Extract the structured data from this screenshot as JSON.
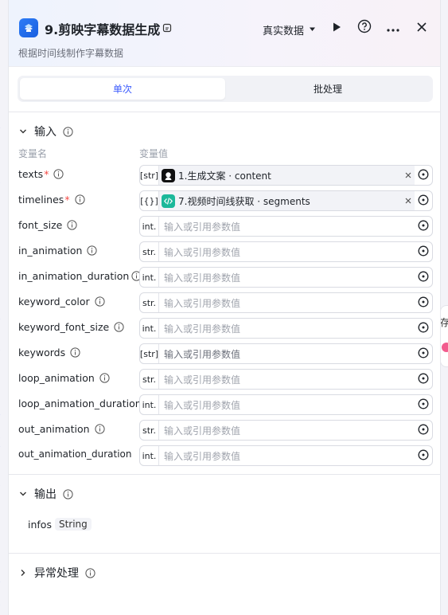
{
  "canvas": {
    "right_node_label": "存"
  },
  "header": {
    "title": "9.剪映字幕数据生成",
    "description": "根据时间线制作字幕数据",
    "data_mode": "真实数据",
    "accent_color": "#2d7cf6"
  },
  "tabs": [
    {
      "label": "单次",
      "active": true
    },
    {
      "label": "批处理",
      "active": false
    }
  ],
  "input_section": {
    "title": "输入",
    "col_name": "变量名",
    "col_value": "变量值",
    "rows": [
      {
        "name": "texts",
        "required": "*",
        "type": "[str]",
        "ref_label": "1.生成文案 · content",
        "ref_icon": "ai-avatar-icon"
      },
      {
        "name": "timelines",
        "required": "*",
        "type": "[{}]",
        "ref_label": "7.视频时间线获取 · segments",
        "ref_icon": "code-icon"
      },
      {
        "name": "font_size",
        "type": "int.",
        "placeholder": "输入或引用参数值"
      },
      {
        "name": "in_animation",
        "type": "str.",
        "placeholder": "输入或引用参数值"
      },
      {
        "name": "in_animation_duration",
        "type": "int.",
        "placeholder": "输入或引用参数值"
      },
      {
        "name": "keyword_color",
        "type": "str.",
        "placeholder": "输入或引用参数值"
      },
      {
        "name": "keyword_font_size",
        "type": "int.",
        "placeholder": "输入或引用参数值"
      },
      {
        "name": "keywords",
        "type": "[str]",
        "placeholder": "输入或引用参数值"
      },
      {
        "name": "loop_animation",
        "type": "str.",
        "placeholder": "输入或引用参数值"
      },
      {
        "name": "loop_animation_duration",
        "type": "int.",
        "placeholder": "输入或引用参数值"
      },
      {
        "name": "out_animation",
        "type": "str.",
        "placeholder": "输入或引用参数值"
      },
      {
        "name": "out_animation_duration",
        "type": "int.",
        "placeholder": "输入或引用参数值"
      }
    ]
  },
  "output_section": {
    "title": "输出",
    "var_name": "infos",
    "var_type": "String"
  },
  "exception_section": {
    "title": "异常处理"
  }
}
